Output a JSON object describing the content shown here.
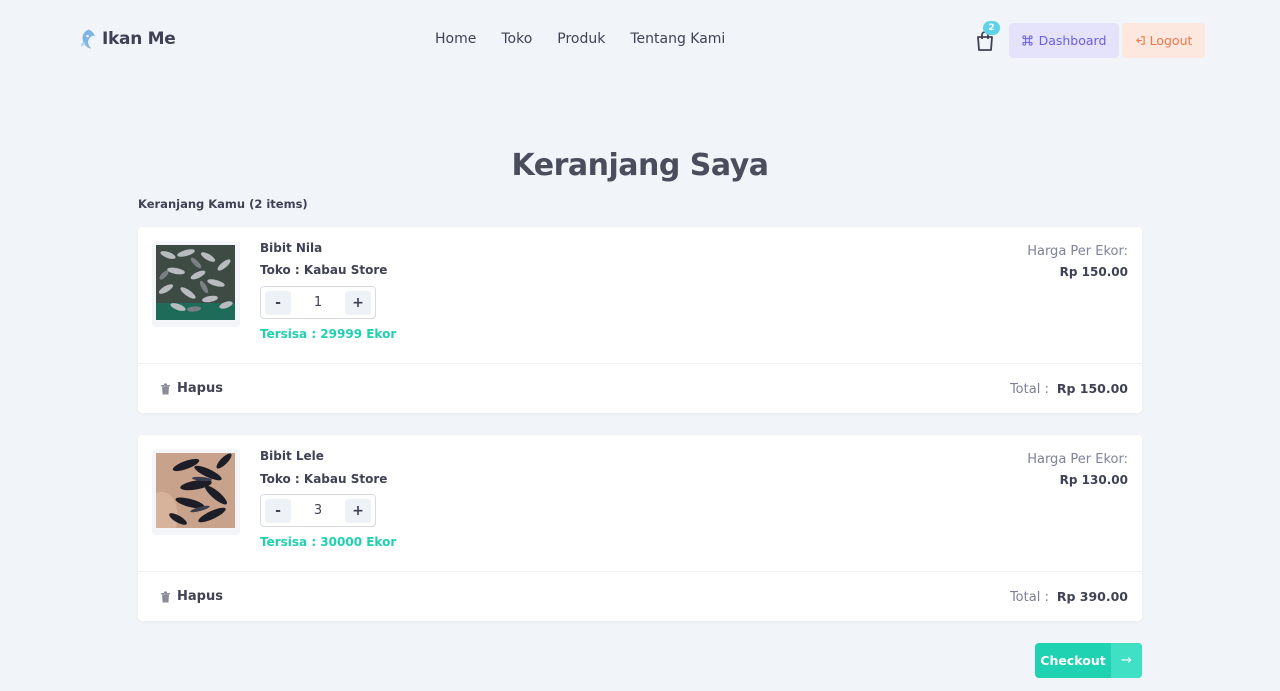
{
  "brand": {
    "name": "Ikan Me",
    "icon": "fish-logo-icon"
  },
  "nav": {
    "items": [
      "Home",
      "Toko",
      "Produk",
      "Tentang Kami"
    ]
  },
  "header": {
    "cart_badge": "2",
    "dashboard_label": "Dashboard",
    "logout_label": "Logout"
  },
  "page": {
    "title": "Keranjang Saya",
    "cart_count": "Keranjang Kamu (2 items)",
    "price_label": "Harga Per Ekor:",
    "delete_label": "Hapus",
    "total_label": "Total :",
    "checkout_label": "Checkout"
  },
  "items": [
    {
      "name": "Bibit Nila",
      "store": "Toko : Kabau Store",
      "qty": "1",
      "stock": "Tersisa : 29999 Ekor",
      "price": "Rp 150.00",
      "total": "Rp 150.00"
    },
    {
      "name": "Bibit Lele",
      "store": "Toko : Kabau Store",
      "qty": "3",
      "stock": "Tersisa : 30000 Ekor",
      "price": "Rp 130.00",
      "total": "Rp 390.00"
    }
  ],
  "colors": {
    "accent": "#1ed2b2",
    "dashboard_bg": "#e4e3fb",
    "logout_bg": "#fce8df",
    "page_bg": "#f1f4f8"
  }
}
